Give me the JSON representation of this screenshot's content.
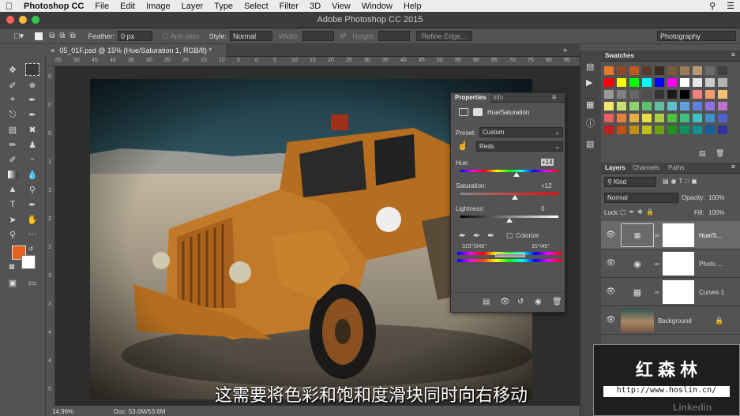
{
  "menubar": {
    "apple": "",
    "app": "Photoshop CC",
    "items": [
      "File",
      "Edit",
      "Image",
      "Layer",
      "Type",
      "Select",
      "Filter",
      "3D",
      "View",
      "Window",
      "Help"
    ]
  },
  "titlebar": {
    "title": "Adobe Photoshop CC 2015"
  },
  "options": {
    "feather_label": "Feather:",
    "feather_value": "0 px",
    "antialias": "Anti-alias",
    "style_label": "Style:",
    "style_value": "Normal",
    "width_label": "Width:",
    "height_label": "Height:",
    "refine": "Refine Edge...",
    "workspace": "Photography"
  },
  "document": {
    "tab": "05_01F.psd @ 15% (Hue/Saturation 1, RGB/8) *",
    "zoom": "14.96%",
    "doc": "Doc: 53.6M/53.6M"
  },
  "rulers": {
    "top": [
      "55",
      "50",
      "45",
      "40",
      "35",
      "30",
      "25",
      "20",
      "15",
      "10",
      "5",
      "0",
      "5",
      "10",
      "15",
      "20",
      "25",
      "30",
      "35",
      "40",
      "45",
      "50",
      "55",
      "60",
      "65",
      "70",
      "75",
      "80",
      "85"
    ],
    "left": [
      "5",
      "0",
      "5",
      "1",
      "1",
      "2",
      "2",
      "3",
      "3",
      "4",
      "4",
      "5"
    ]
  },
  "properties": {
    "tab1": "Properties",
    "tab2": "Info",
    "adj_title": "Hue/Saturation",
    "preset_label": "Preset:",
    "preset_value": "Custom",
    "channel_value": "Reds",
    "hue_label": "Hue:",
    "hue_value": "+14",
    "sat_label": "Saturation:",
    "sat_value": "+12",
    "light_label": "Lightness:",
    "light_value": "0",
    "colorize": "Colorize",
    "range_left": "315°/345°",
    "range_right": "15°\\45°",
    "hue_fraction": 0.57,
    "sat_fraction": 0.56,
    "light_fraction": 0.5
  },
  "swatches": {
    "title": "Swatches",
    "colors": [
      [
        "#e8782a",
        "#8a4a24",
        "#c05a20",
        "#5a3a28",
        "#3a2a22",
        "#7a5a3a",
        "#9a7a5a",
        "#b89a78",
        "#6a6a6a",
        "#404040"
      ],
      [
        "#ff0000",
        "#ffff00",
        "#00ff00",
        "#00ffff",
        "#0000ff",
        "#ff00ff",
        "#ffffff",
        "#e6e6e6",
        "#cccccc",
        "#b3b3b3"
      ],
      [
        "#999999",
        "#808080",
        "#666666",
        "#4d4d4d",
        "#333333",
        "#1a1a1a",
        "#000000",
        "#f08080",
        "#f49a6e",
        "#f8c070"
      ],
      [
        "#f8e870",
        "#c8e070",
        "#90d070",
        "#60c070",
        "#60c0a0",
        "#60c0d0",
        "#60a0e0",
        "#6080e0",
        "#9070e0",
        "#c070d0"
      ],
      [
        "#e86060",
        "#e88040",
        "#e8b040",
        "#e8e040",
        "#a8d040",
        "#50c040",
        "#40c080",
        "#40c0c0",
        "#4090d0",
        "#5060d0"
      ],
      [
        "#c02020",
        "#c05010",
        "#c09010",
        "#c0c010",
        "#70a010",
        "#209020",
        "#109060",
        "#109090",
        "#1060a0",
        "#3030a0"
      ]
    ]
  },
  "layers_panel": {
    "tabs": [
      "Layers",
      "Channels",
      "Paths"
    ],
    "kind": "Kind",
    "blend": "Normal",
    "opacity_label": "Opacity:",
    "opacity_value": "100%",
    "lock_label": "Lock:",
    "fill_label": "Fill:",
    "fill_value": "100%",
    "layers": [
      {
        "name": "Hue/S...",
        "type": "hue-saturation"
      },
      {
        "name": "Photo ...",
        "type": "photo-filter"
      },
      {
        "name": "Curves 1",
        "type": "curves"
      },
      {
        "name": "Background",
        "type": "background"
      }
    ]
  },
  "subtitle": "这需要将色彩和饱和度滑块同时向右移动",
  "watermark": {
    "name": "红 森 林",
    "url": "http://www.hoslin.cn/",
    "brand": "Linkedin"
  }
}
